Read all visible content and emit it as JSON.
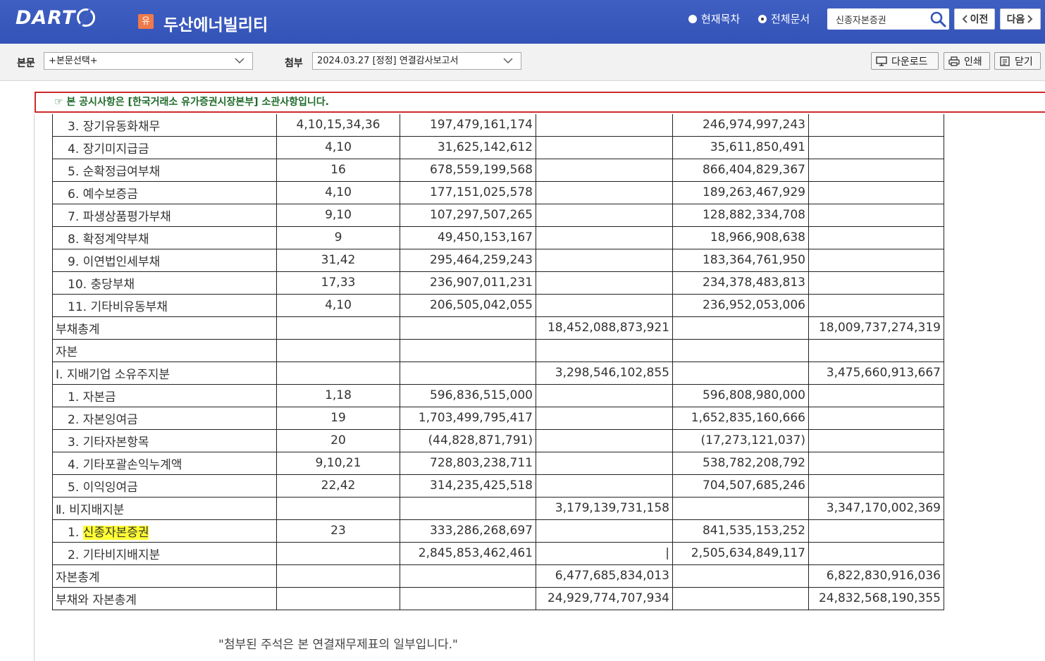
{
  "header": {
    "logo_text": "DART",
    "badge": "유",
    "company_name": "두산에너빌리티",
    "radio_current": "현재목차",
    "radio_all": "전체문서",
    "search_value": "신종자본증권",
    "prev_label": "이전",
    "next_label": "다음"
  },
  "subbar": {
    "body_label": "본문",
    "body_select": "+본문선택+",
    "attach_label": "첨부",
    "attach_select": "2024.03.27  [정정] 연결감사보고서",
    "download_label": "다운로드",
    "print_label": "인쇄",
    "close_label": "닫기"
  },
  "notice": "☞ 본 공시사항은 [한국거래소 유가증권시장본부] 소관사항입니다.",
  "table": {
    "rows": [
      {
        "name": "3. 장기유동화채무",
        "indent": true,
        "note": "4,10,15,34,36",
        "c2": "197,479,161,174",
        "c3": "",
        "c4": "246,974,997,243",
        "c5": ""
      },
      {
        "name": "4. 장기미지급금",
        "indent": true,
        "note": "4,10",
        "c2": "31,625,142,612",
        "c3": "",
        "c4": "35,611,850,491",
        "c5": ""
      },
      {
        "name": "5. 순확정급여부채",
        "indent": true,
        "note": "16",
        "c2": "678,559,199,568",
        "c3": "",
        "c4": "866,404,829,367",
        "c5": ""
      },
      {
        "name": "6. 예수보증금",
        "indent": true,
        "note": "4,10",
        "c2": "177,151,025,578",
        "c3": "",
        "c4": "189,263,467,929",
        "c5": ""
      },
      {
        "name": "7. 파생상품평가부채",
        "indent": true,
        "note": "9,10",
        "c2": "107,297,507,265",
        "c3": "",
        "c4": "128,882,334,708",
        "c5": ""
      },
      {
        "name": "8. 확정계약부채",
        "indent": true,
        "note": "9",
        "c2": "49,450,153,167",
        "c3": "",
        "c4": "18,966,908,638",
        "c5": ""
      },
      {
        "name": "9. 이연법인세부채",
        "indent": true,
        "note": "31,42",
        "c2": "295,464,259,243",
        "c3": "",
        "c4": "183,364,761,950",
        "c5": ""
      },
      {
        "name": "10. 충당부채",
        "indent": true,
        "note": "17,33",
        "c2": "236,907,011,231",
        "c3": "",
        "c4": "234,378,483,813",
        "c5": ""
      },
      {
        "name": "11. 기타비유동부채",
        "indent": true,
        "note": "4,10",
        "c2": "206,505,042,055",
        "c3": "",
        "c4": "236,952,053,006",
        "c5": ""
      },
      {
        "name": "부채총계",
        "indent": false,
        "note": "",
        "c2": "",
        "c3": "18,452,088,873,921",
        "c4": "",
        "c5": "18,009,737,274,319"
      },
      {
        "name": "자본",
        "indent": false,
        "note": "",
        "c2": "",
        "c3": "",
        "c4": "",
        "c5": ""
      },
      {
        "name": " Ⅰ. 지배기업 소유주지분",
        "indent": false,
        "note": "",
        "c2": "",
        "c3": "3,298,546,102,855",
        "c4": "",
        "c5": "3,475,660,913,667"
      },
      {
        "name": "1. 자본금",
        "indent": true,
        "note": "1,18",
        "c2": "596,836,515,000",
        "c3": "",
        "c4": "596,808,980,000",
        "c5": ""
      },
      {
        "name": "2. 자본잉여금",
        "indent": true,
        "note": "19",
        "c2": "1,703,499,795,417",
        "c3": "",
        "c4": "1,652,835,160,666",
        "c5": ""
      },
      {
        "name": "3. 기타자본항목",
        "indent": true,
        "note": "20",
        "c2": "(44,828,871,791)",
        "c3": "",
        "c4": "(17,273,121,037)",
        "c5": ""
      },
      {
        "name": "4. 기타포괄손익누계액",
        "indent": true,
        "note": "9,10,21",
        "c2": "728,803,238,711",
        "c3": "",
        "c4": "538,782,208,792",
        "c5": ""
      },
      {
        "name": "5. 이익잉여금",
        "indent": true,
        "note": "22,42",
        "c2": "314,235,425,518",
        "c3": "",
        "c4": "704,507,685,246",
        "c5": ""
      },
      {
        "name": " Ⅱ. 비지배지분",
        "indent": false,
        "note": "",
        "c2": "",
        "c3": "3,179,139,731,158",
        "c4": "",
        "c5": "3,347,170,002,369"
      },
      {
        "name": "1. ",
        "highlight": "신종자본증권",
        "indent": true,
        "note": "23",
        "c2": "333,286,268,697",
        "c3": "",
        "c4": "841,535,153,252",
        "c5": ""
      },
      {
        "name": "2. 기타비지배지분",
        "indent": true,
        "note": "",
        "c2": "2,845,853,462,461",
        "c3": "|",
        "c4": "2,505,634,849,117",
        "c5": ""
      },
      {
        "name": "자본총계",
        "indent": false,
        "note": "",
        "c2": "",
        "c3": "6,477,685,834,013",
        "c4": "",
        "c5": "6,822,830,916,036"
      },
      {
        "name": "부채와 자본총계",
        "indent": false,
        "note": "",
        "c2": "",
        "c3": "24,929,774,707,934",
        "c4": "",
        "c5": "24,832,568,190,355"
      }
    ]
  },
  "footnote": "\"첨부된 주석은 본 연결재무제표의 일부입니다.\"",
  "colors": {
    "topbar": "#3f5fc2",
    "notice_border": "#cf2a2a",
    "notice_text": "#1f6b2a",
    "highlight": "#ffff33"
  }
}
